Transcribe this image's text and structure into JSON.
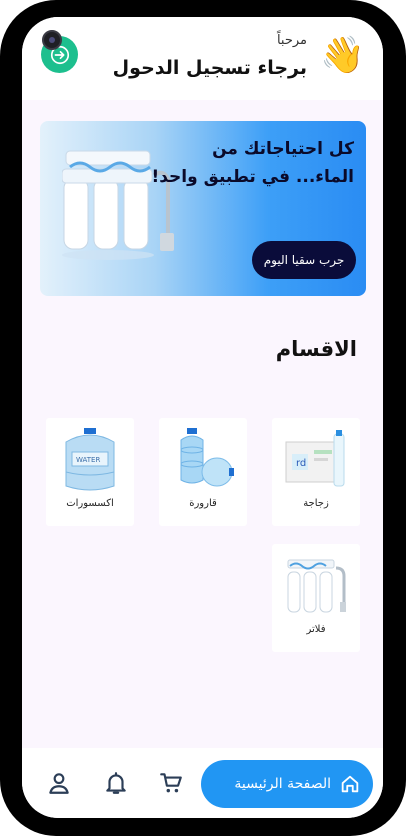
{
  "header": {
    "greeting_small": "مرحباً",
    "greeting_big": "برجاء تسجيل الدحول",
    "wave_emoji": "👋",
    "login_icon": "login-arrow-icon",
    "accent": "#1dbf8e"
  },
  "banner": {
    "line1": "كل احتياجاتك من",
    "line2": "الماء... في تطبيق واحد!",
    "cta": "جرب سقيا اليوم",
    "image": "water-filter-image"
  },
  "categories": {
    "title": "الاقسام",
    "items": [
      {
        "label": "زجاجة",
        "icon": "bottle-pack-image"
      },
      {
        "label": "قارورة",
        "icon": "water-jug-image"
      },
      {
        "label": "اكسسورات",
        "icon": "accessory-jug-image"
      },
      {
        "label": "فلاتر",
        "icon": "filter-image"
      }
    ]
  },
  "bottom_nav": {
    "home_label": "الصفحة الرئيسية",
    "home_icon": "home-icon",
    "cart_icon": "cart-icon",
    "bell_icon": "bell-icon",
    "user_icon": "user-icon",
    "accent": "#2196f3"
  }
}
